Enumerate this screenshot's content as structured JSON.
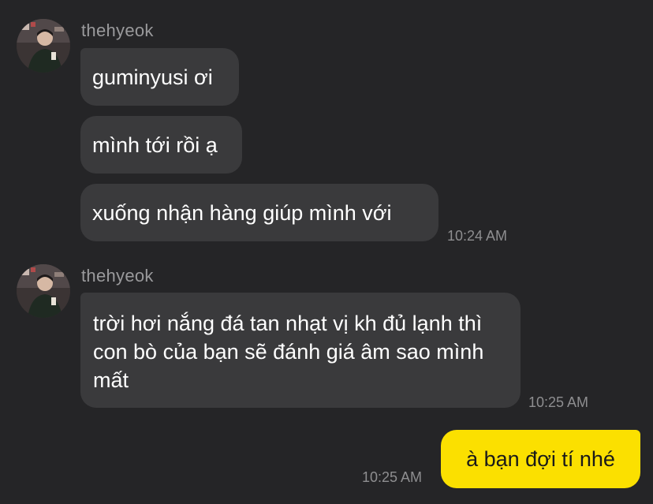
{
  "colors": {
    "background": "#252527",
    "incoming_bubble": "#3a3a3c",
    "outgoing_bubble": "#fbe000",
    "sender_name": "#9a9a9c",
    "timestamp": "#8e8e90"
  },
  "groups": [
    {
      "sender": "thehyeok",
      "messages": [
        "guminyusi ơi",
        "mình tới rồi ạ",
        "xuống nhận hàng giúp mình với"
      ],
      "time": "10:24 AM"
    },
    {
      "sender": "thehyeok",
      "messages": [
        "trời hơi nắng đá tan nhạt vị kh đủ lạnh thì con bò của bạn sẽ đánh giá âm sao mình mất"
      ],
      "time": "10:25 AM"
    }
  ],
  "outgoing": {
    "text": "à bạn đợi tí nhé",
    "time": "10:25 AM"
  }
}
